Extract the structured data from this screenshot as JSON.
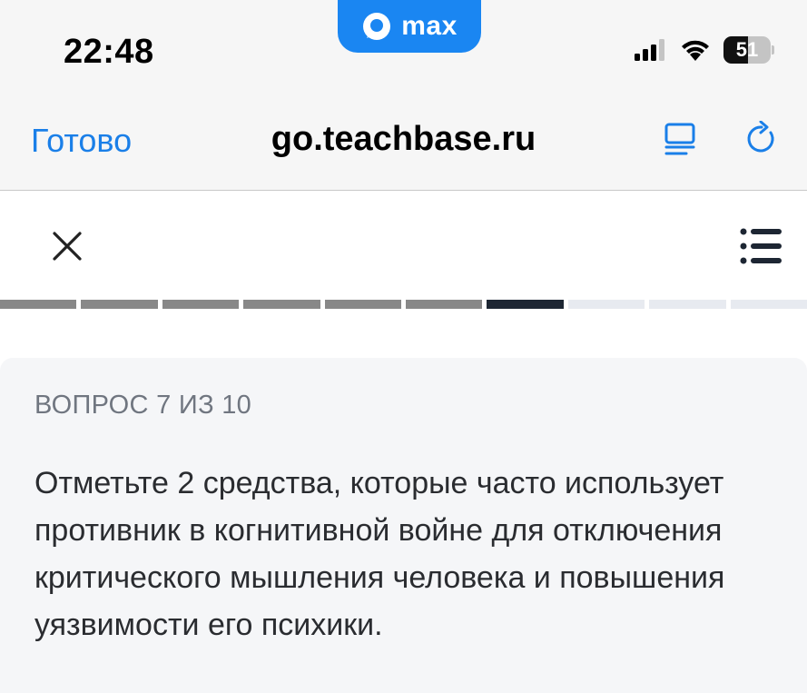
{
  "status_bar": {
    "time": "22:48",
    "app_name": "max",
    "battery_percent": "51",
    "battery_level": 0.51,
    "icons": [
      "signal-icon",
      "wifi-icon",
      "battery-icon"
    ]
  },
  "browser": {
    "done_label": "Готово",
    "url": "go.teachbase.ru",
    "icons": [
      "reader-icon",
      "reload-icon"
    ],
    "accent_color": "#1a7fe8"
  },
  "quiz": {
    "icons": [
      "close-icon",
      "menu-list-icon"
    ],
    "progress": {
      "total": 10,
      "current": 7,
      "segments": [
        "done",
        "done",
        "done",
        "done",
        "done",
        "done",
        "current",
        "todo",
        "todo",
        "todo"
      ]
    },
    "question_counter": "ВОПРОС 7 ИЗ 10",
    "question_text": "Отметьте 2 средства, которые часто использует противник в когнитивной войне для отключения критического мышления человека и повышения уязвимости его психики."
  }
}
